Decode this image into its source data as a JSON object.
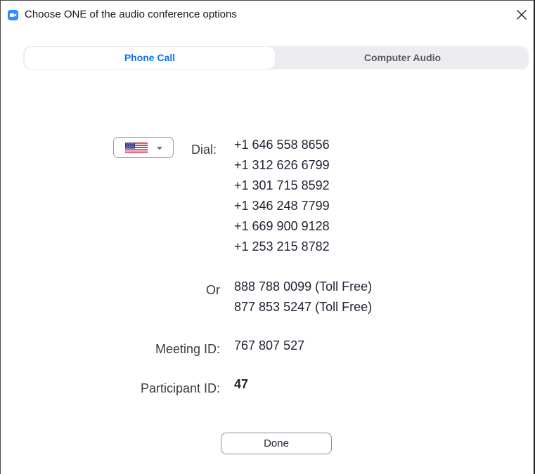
{
  "window": {
    "title": "Choose ONE of the audio conference options",
    "app_icon": "zoom-camera-icon",
    "close_icon": "close-icon"
  },
  "tabs": [
    {
      "label": "Phone Call",
      "active": true
    },
    {
      "label": "Computer Audio",
      "active": false
    }
  ],
  "country": {
    "flag": "us-flag-icon",
    "dropdown_icon": "chevron-down-icon"
  },
  "dial": {
    "label": "Dial:",
    "numbers": [
      "+1 646 558 8656",
      "+1 312 626 6799",
      "+1 301 715 8592",
      "+1 346 248 7799",
      "+1 669 900 9128",
      "+1 253 215 8782"
    ]
  },
  "toll_free": {
    "label": "Or",
    "numbers": [
      "888 788 0099 (Toll Free)",
      "877 853 5247 (Toll Free)"
    ]
  },
  "meeting": {
    "label": "Meeting ID:",
    "value": "767 807 527"
  },
  "participant": {
    "label": "Participant ID:",
    "value": "47"
  },
  "done_label": "Done",
  "colors": {
    "accent": "#0e71eb",
    "tab_background": "#ededf1",
    "text": "#232333"
  }
}
